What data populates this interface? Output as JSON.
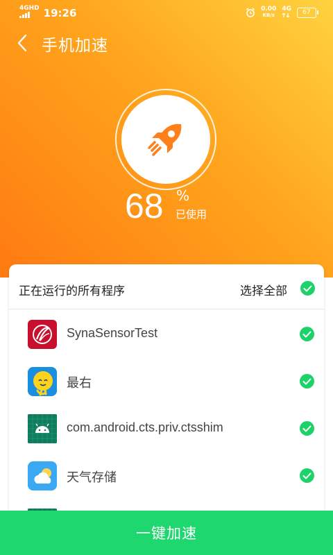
{
  "status_bar": {
    "signal_top": "4GHD",
    "signal_bottom": "",
    "time": "19:26",
    "speed_value": "0.00",
    "speed_unit": "KB/s",
    "network": "4G",
    "battery": "67"
  },
  "header": {
    "title": "手机加速"
  },
  "gauge": {
    "usage_value": "68",
    "usage_unit": "%",
    "usage_label": "已使用",
    "icon": "rocket-icon"
  },
  "running_list": {
    "title": "正在运行的所有程序",
    "select_all_label": "选择全部",
    "select_all_checked": true,
    "apps": [
      {
        "name": "SynaSensorTest",
        "icon": "synasensor-app-icon",
        "checked": true
      },
      {
        "name": "最右",
        "icon": "zuiyou-app-icon",
        "checked": true
      },
      {
        "name": "com.android.cts.priv.ctsshim",
        "icon": "android-app-icon",
        "checked": true
      },
      {
        "name": "天气存储",
        "icon": "weather-app-icon",
        "checked": true
      }
    ]
  },
  "action": {
    "label": "一键加速"
  },
  "colors": {
    "accent_green": "#1ed76e",
    "hero_orange": "#ff8a14",
    "hero_yellow": "#ffd23f"
  }
}
